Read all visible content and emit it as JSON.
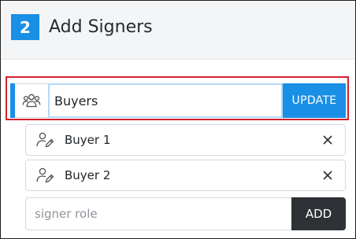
{
  "header": {
    "step_number": "2",
    "title": "Add Signers"
  },
  "signer_group": {
    "icon": "users-icon",
    "value": "Buyers",
    "update_label": "UPDATE",
    "accent_color": "#1a8fe6",
    "highlight_color": "#d42030"
  },
  "signers": [
    {
      "icon": "user-edit-icon",
      "label": "Buyer 1",
      "remove_icon": "close-icon"
    },
    {
      "icon": "user-edit-icon",
      "label": "Buyer 2",
      "remove_icon": "close-icon"
    }
  ],
  "add_role": {
    "placeholder": "signer role",
    "value": "",
    "add_label": "ADD"
  }
}
